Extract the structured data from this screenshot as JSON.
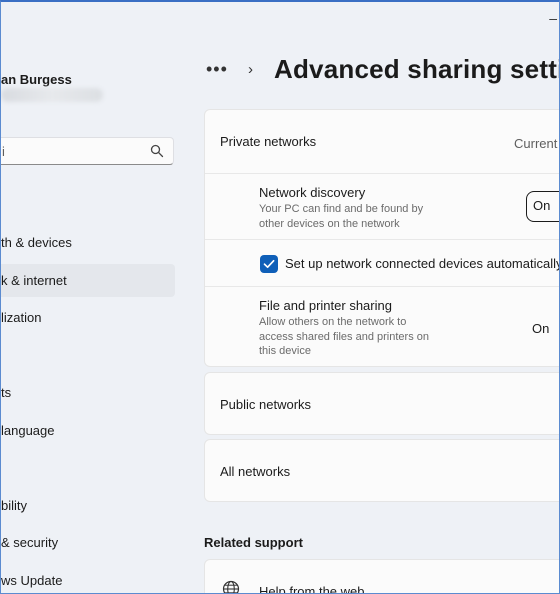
{
  "window": {
    "minimize_label": "–"
  },
  "user": {
    "name": "an Burgess"
  },
  "search": {
    "value": "i"
  },
  "sidebar": {
    "items": [
      {
        "label": "th & devices"
      },
      {
        "label": "k & internet",
        "selected": true
      },
      {
        "label": "lization"
      },
      {
        "label": ""
      },
      {
        "label": "ts"
      },
      {
        "label": "language"
      },
      {
        "label": ""
      },
      {
        "label": "bility"
      },
      {
        "label": "& security"
      },
      {
        "label": "ws Update"
      }
    ]
  },
  "header": {
    "dots": "•••",
    "chevron": "›",
    "title": "Advanced sharing settings"
  },
  "private": {
    "title": "Private networks",
    "status": "Current",
    "discovery": {
      "title": "Network discovery",
      "desc1": "Your PC can find and be found by",
      "desc2": "other devices on the network",
      "state": "On"
    },
    "auto_setup": {
      "label": "Set up network connected devices automatically",
      "checked": true
    },
    "sharing": {
      "title": "File and printer sharing",
      "desc1": "Allow others on the network to",
      "desc2": "access shared files and printers on",
      "desc3": "this device",
      "state": "On"
    }
  },
  "public": {
    "title": "Public networks"
  },
  "all": {
    "title": "All networks"
  },
  "related": {
    "heading": "Related support",
    "help_label": "Help from the web"
  },
  "colors": {
    "accent": "#0f5fb8",
    "background": "#eef1f6",
    "card": "#fbfbfb"
  }
}
